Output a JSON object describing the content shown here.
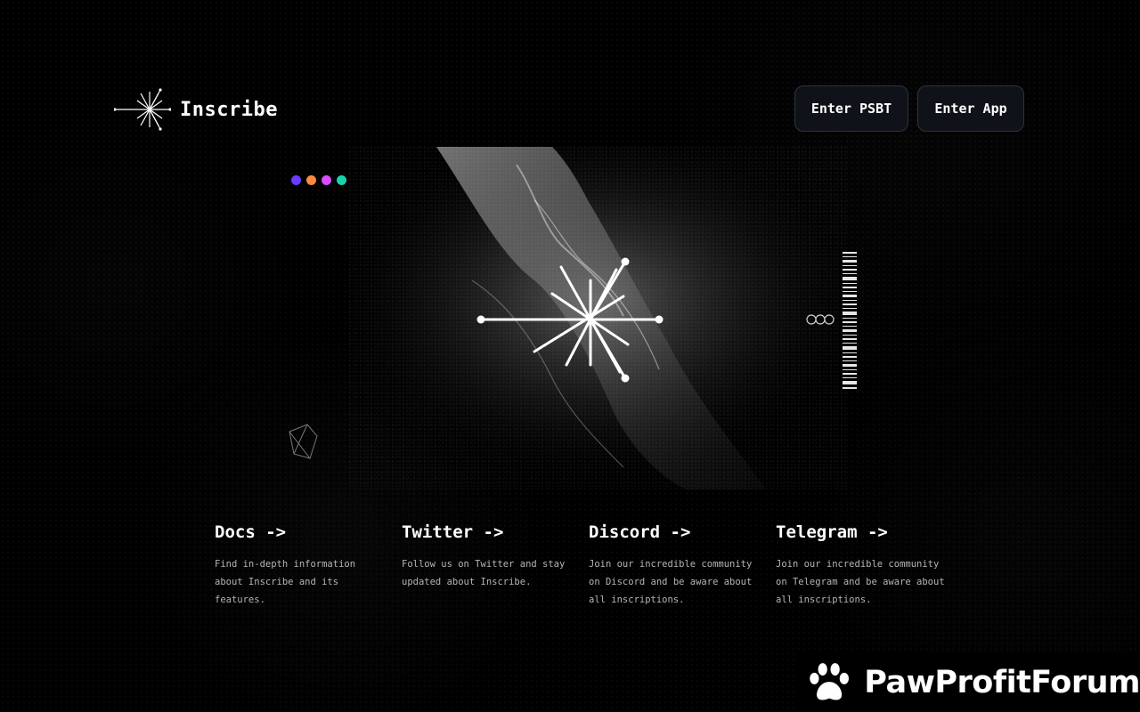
{
  "brand": {
    "name": "Inscribe",
    "logo_icon": "starburst-icon"
  },
  "header": {
    "enter_psbt_label": "Enter PSBT",
    "enter_app_label": "Enter App"
  },
  "hero": {
    "window_dots": [
      "#6a3cff",
      "#ff8a3d",
      "#d94cff",
      "#19d3b0"
    ],
    "center_icon": "starburst-icon"
  },
  "links": [
    {
      "title": "Docs ->",
      "description": "Find in-depth information about Inscribe and its features."
    },
    {
      "title": "Twitter ->",
      "description": "Follow us on Twitter and stay updated about Inscribe."
    },
    {
      "title": "Discord ->",
      "description": "Join our incredible community on Discord and be aware about all inscriptions."
    },
    {
      "title": "Telegram ->",
      "description": "Join our incredible community on Telegram and be aware about all inscriptions."
    }
  ],
  "watermark": {
    "text": "PawProfitForum",
    "icon": "paw-icon"
  }
}
